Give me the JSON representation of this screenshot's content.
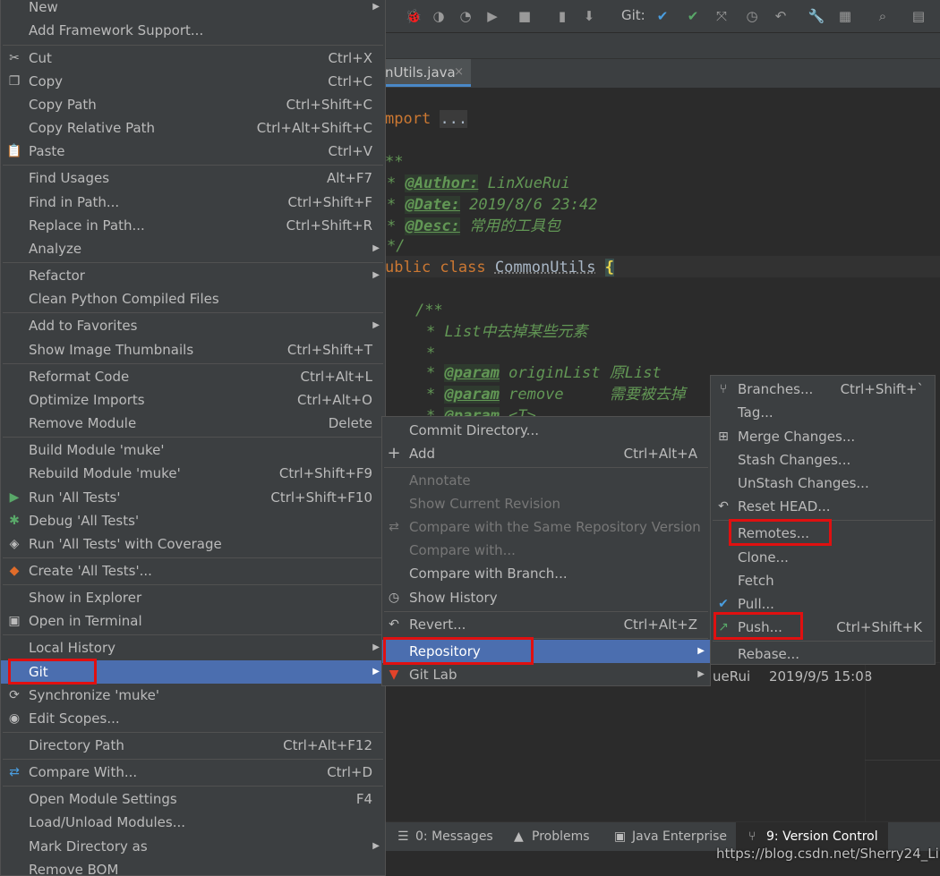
{
  "toolbar": {
    "git_label": "Git:"
  },
  "editor": {
    "tab_name": "nUtils.java",
    "tab_close": "×",
    "lines": {
      "import_kw": "mport",
      "import_fold": "...",
      "doc_open": "**",
      "author_tag": "@Author:",
      "author_val": " LinXueRui",
      "date_tag": "@Date:",
      "date_val": " 2019/8/6 23:42",
      "desc_tag": "@Desc:",
      "desc_val": " 常用的工具包",
      "doc_close": "*/",
      "public_kw": "ublic class",
      "class_name": "CommonUtils",
      "brace": "{",
      "m_doc_open": "/**",
      "m_doc_text": "* List中去掉某些元素",
      "m_doc_star": "*",
      "param1_tag": "@param",
      "param1_text": " originList 原List",
      "param2_tag": "@param",
      "param2_text": " remove     需要被去掉",
      "param3_tag": "@param",
      "param3_text": " <T>"
    }
  },
  "log_row": {
    "author": "ueRui",
    "date": "2019/9/5 15:08"
  },
  "bottom_tabs": [
    {
      "label": "0: Messages"
    },
    {
      "label": "Problems"
    },
    {
      "label": "Java Enterprise"
    },
    {
      "label": "9: Version Control"
    }
  ],
  "watermark": "https://blog.csdn.net/Sherry24_Lin",
  "context_menu": [
    {
      "label": "New",
      "shortcut": ""
    },
    {
      "label": "Add Framework Support...",
      "shortcut": ""
    },
    {
      "label": "Cut",
      "shortcut": "Ctrl+X"
    },
    {
      "label": "Copy",
      "shortcut": "Ctrl+C"
    },
    {
      "label": "Copy Path",
      "shortcut": "Ctrl+Shift+C"
    },
    {
      "label": "Copy Relative Path",
      "shortcut": "Ctrl+Alt+Shift+C"
    },
    {
      "label": "Paste",
      "shortcut": "Ctrl+V"
    },
    {
      "label": "Find Usages",
      "shortcut": "Alt+F7"
    },
    {
      "label": "Find in Path...",
      "shortcut": "Ctrl+Shift+F"
    },
    {
      "label": "Replace in Path...",
      "shortcut": "Ctrl+Shift+R"
    },
    {
      "label": "Analyze",
      "shortcut": ""
    },
    {
      "label": "Refactor",
      "shortcut": ""
    },
    {
      "label": "Clean Python Compiled Files",
      "shortcut": ""
    },
    {
      "label": "Add to Favorites",
      "shortcut": ""
    },
    {
      "label": "Show Image Thumbnails",
      "shortcut": "Ctrl+Shift+T"
    },
    {
      "label": "Reformat Code",
      "shortcut": "Ctrl+Alt+L"
    },
    {
      "label": "Optimize Imports",
      "shortcut": "Ctrl+Alt+O"
    },
    {
      "label": "Remove Module",
      "shortcut": "Delete"
    },
    {
      "label": "Build Module 'muke'",
      "shortcut": ""
    },
    {
      "label": "Rebuild Module 'muke'",
      "shortcut": "Ctrl+Shift+F9"
    },
    {
      "label": "Run 'All Tests'",
      "shortcut": "Ctrl+Shift+F10"
    },
    {
      "label": "Debug 'All Tests'",
      "shortcut": ""
    },
    {
      "label": "Run 'All Tests' with Coverage",
      "shortcut": ""
    },
    {
      "label": "Create 'All Tests'...",
      "shortcut": ""
    },
    {
      "label": "Show in Explorer",
      "shortcut": ""
    },
    {
      "label": "Open in Terminal",
      "shortcut": ""
    },
    {
      "label": "Local History",
      "shortcut": ""
    },
    {
      "label": "Git",
      "shortcut": ""
    },
    {
      "label": "Synchronize 'muke'",
      "shortcut": ""
    },
    {
      "label": "Edit Scopes...",
      "shortcut": ""
    },
    {
      "label": "Directory Path",
      "shortcut": "Ctrl+Alt+F12"
    },
    {
      "label": "Compare With...",
      "shortcut": "Ctrl+D"
    },
    {
      "label": "Open Module Settings",
      "shortcut": "F4"
    },
    {
      "label": "Load/Unload Modules...",
      "shortcut": ""
    },
    {
      "label": "Mark Directory as",
      "shortcut": ""
    },
    {
      "label": "Remove BOM",
      "shortcut": ""
    }
  ],
  "git_menu": [
    {
      "label": "Commit Directory...",
      "shortcut": ""
    },
    {
      "label": "Add",
      "shortcut": "Ctrl+Alt+A"
    },
    {
      "label": "Annotate",
      "shortcut": ""
    },
    {
      "label": "Show Current Revision",
      "shortcut": ""
    },
    {
      "label": "Compare with the Same Repository Version",
      "shortcut": ""
    },
    {
      "label": "Compare with...",
      "shortcut": ""
    },
    {
      "label": "Compare with Branch...",
      "shortcut": ""
    },
    {
      "label": "Show History",
      "shortcut": ""
    },
    {
      "label": "Revert...",
      "shortcut": "Ctrl+Alt+Z"
    },
    {
      "label": "Repository",
      "shortcut": ""
    },
    {
      "label": "Git Lab",
      "shortcut": ""
    }
  ],
  "repo_menu": [
    {
      "label": "Branches...",
      "shortcut": "Ctrl+Shift+`"
    },
    {
      "label": "Tag...",
      "shortcut": ""
    },
    {
      "label": "Merge Changes...",
      "shortcut": ""
    },
    {
      "label": "Stash Changes...",
      "shortcut": ""
    },
    {
      "label": "UnStash Changes...",
      "shortcut": ""
    },
    {
      "label": "Reset HEAD...",
      "shortcut": ""
    },
    {
      "label": "Remotes...",
      "shortcut": ""
    },
    {
      "label": "Clone...",
      "shortcut": ""
    },
    {
      "label": "Fetch",
      "shortcut": ""
    },
    {
      "label": "Pull...",
      "shortcut": ""
    },
    {
      "label": "Push...",
      "shortcut": "Ctrl+Shift+K"
    },
    {
      "label": "Rebase...",
      "shortcut": ""
    }
  ],
  "colors": {
    "menu_bg": "#3c3f41",
    "selection": "#4b6eaf",
    "highlight_box": "#e01010",
    "editor_bg": "#2b2b2b"
  }
}
